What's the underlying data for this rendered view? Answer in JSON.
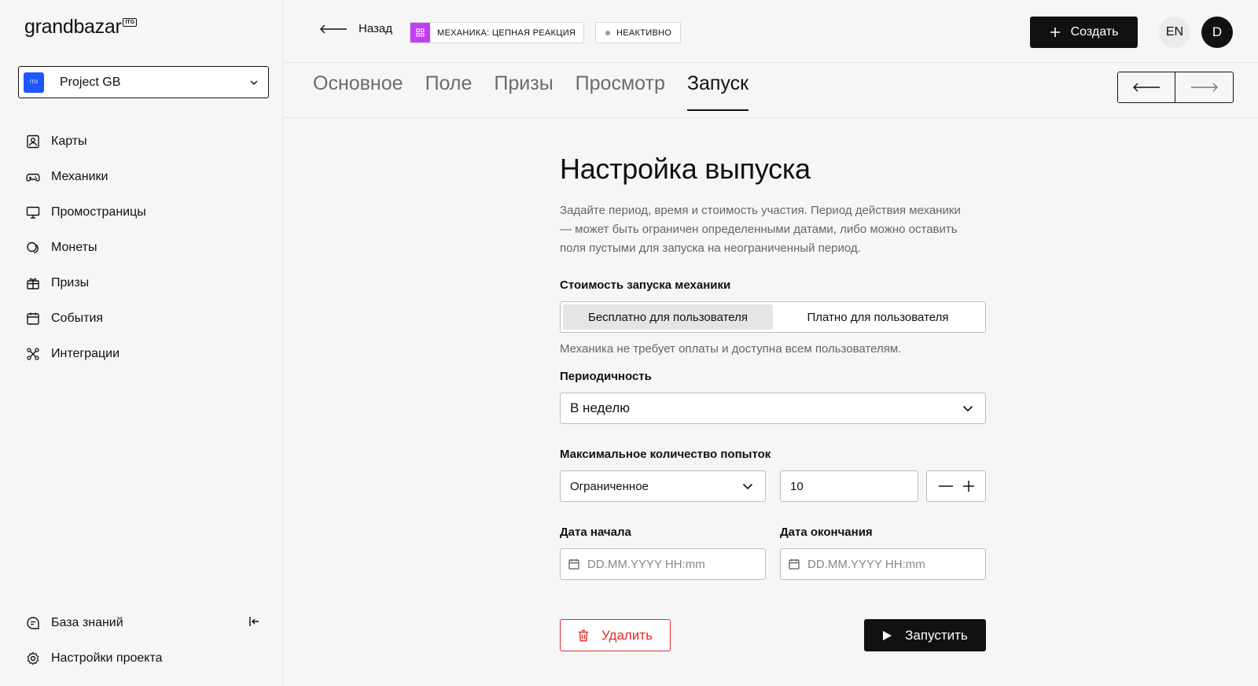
{
  "brand": {
    "name": "grandbazar",
    "badge": "ITG"
  },
  "project": {
    "name": "Project GB",
    "logo_text": "ITG"
  },
  "nav": {
    "items": [
      {
        "label": "Карты",
        "icon": "card-icon"
      },
      {
        "label": "Механики",
        "icon": "gamepad-icon"
      },
      {
        "label": "Промостраницы",
        "icon": "monitor-icon"
      },
      {
        "label": "Монеты",
        "icon": "coins-icon"
      },
      {
        "label": "Призы",
        "icon": "gift-icon"
      },
      {
        "label": "События",
        "icon": "calendar-icon"
      },
      {
        "label": "Интеграции",
        "icon": "integrations-icon"
      }
    ],
    "bottom": [
      {
        "label": "База знаний",
        "icon": "chat-icon"
      },
      {
        "label": "Настройки проекта",
        "icon": "gear-icon"
      }
    ]
  },
  "topbar": {
    "back_label": "Назад",
    "mechanic_chip": "МЕХАНИКА: ЦЕПНАЯ РЕАКЦИЯ",
    "status_chip": "НЕАКТИВНО",
    "create_label": "Создать",
    "lang": "EN",
    "avatar_initial": "D"
  },
  "colors": {
    "accent": "#111111",
    "project": "#1f57ff",
    "mechanic": "#c23ef6",
    "danger": "#e12b2b"
  },
  "tabs": [
    {
      "label": "Основное"
    },
    {
      "label": "Поле"
    },
    {
      "label": "Призы"
    },
    {
      "label": "Просмотр"
    },
    {
      "label": "Запуск",
      "active": true
    }
  ],
  "main": {
    "title": "Настройка выпуска",
    "description": "Задайте период, время и стоимость участия. Период действия механики — может быть ограничен определенными датами, либо можно оставить поля пустыми для запуска на неограниченный период.",
    "cost": {
      "label": "Стоимость запуска механики",
      "options": [
        "Бесплатно для пользователя",
        "Платно для пользователя"
      ],
      "selected": "Бесплатно для пользователя",
      "hint": "Механика не требует оплаты и доступна всем пользователям."
    },
    "periodicity": {
      "label": "Периодичность",
      "value": "В неделю"
    },
    "attempts": {
      "label": "Максимальное количество попыток",
      "mode": "Ограниченное",
      "value": "10"
    },
    "start_date": {
      "label": "Дата начала",
      "placeholder": "DD.MM.YYYY HH:mm"
    },
    "end_date": {
      "label": "Дата окончания",
      "placeholder": "DD.MM.YYYY HH:mm"
    },
    "delete_label": "Удалить",
    "launch_label": "Запустить"
  }
}
